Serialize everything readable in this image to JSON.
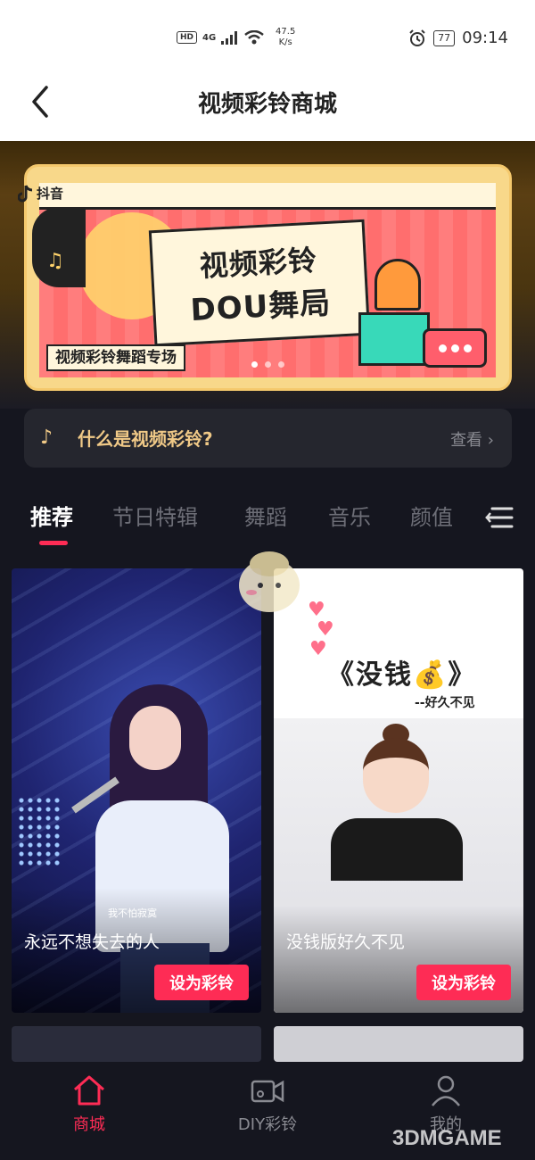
{
  "status_bar": {
    "hd": "HD",
    "network": "4G",
    "speed_value": "47.5",
    "speed_unit": "K/s",
    "battery": "77",
    "time": "09:14"
  },
  "header": {
    "title": "视频彩铃商城"
  },
  "banner": {
    "brand": "抖音",
    "title_line1": "视频彩铃",
    "title_line2": "DOU舞局",
    "subtitle": "视频彩铃舞蹈专场",
    "colors": {
      "background": "#f8d88a",
      "panel": "#ff6e6e",
      "bell": "#ff9a3c",
      "teal": "#38d9b9"
    }
  },
  "info_bar": {
    "text": "什么是视频彩铃?",
    "link": "查看"
  },
  "tabs": [
    {
      "label": "推荐",
      "active": true
    },
    {
      "label": "节日特辑",
      "active": false
    },
    {
      "label": "舞蹈",
      "active": false
    },
    {
      "label": "音乐",
      "active": false
    },
    {
      "label": "颜值",
      "active": false
    }
  ],
  "cards": [
    {
      "caption": "我不怕寂寞",
      "title": "永远不想失去的人",
      "button": "设为彩铃"
    },
    {
      "headline": "《没钱💰》",
      "sub": "--好久不见",
      "title": "没钱版好久不见",
      "button": "设为彩铃"
    }
  ],
  "bottom_nav": [
    {
      "label": "商城",
      "icon": "home-icon",
      "active": true
    },
    {
      "label": "DIY彩铃",
      "icon": "video-camera-icon",
      "active": false
    },
    {
      "label": "我的",
      "icon": "person-icon",
      "active": false
    }
  ],
  "watermark": "3DMGAME",
  "colors": {
    "accent": "#fe2c55",
    "gold": "#f0c987",
    "background": "#15161f"
  }
}
